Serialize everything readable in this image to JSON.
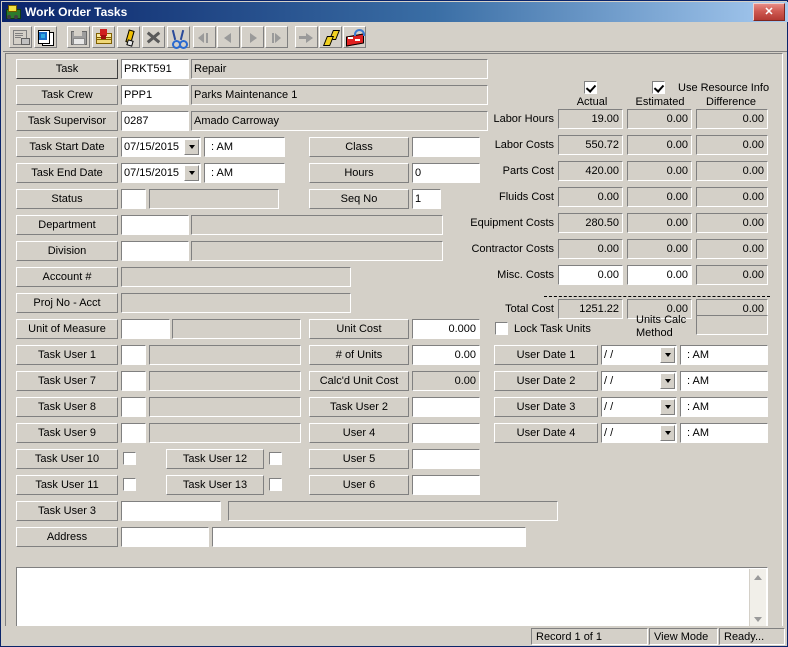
{
  "window": {
    "title": "Work Order Tasks",
    "icon": "bulldozer-icon",
    "close_label": "✕"
  },
  "toolbar": {
    "buttons": [
      {
        "name": "new-record-icon",
        "title": ""
      },
      {
        "name": "copy-record-icon",
        "title": ""
      },
      {
        "name": "save-icon",
        "title": ""
      },
      {
        "name": "post-icon",
        "title": ""
      },
      {
        "name": "edit-pencil-icon",
        "title": ""
      },
      {
        "name": "delete-x-icon",
        "title": ""
      },
      {
        "name": "cut-scissors-icon",
        "title": ""
      },
      {
        "name": "first-record-icon",
        "title": ""
      },
      {
        "name": "previous-record-icon",
        "title": ""
      },
      {
        "name": "next-record-icon",
        "title": ""
      },
      {
        "name": "last-record-icon",
        "title": ""
      },
      {
        "name": "goto-icon",
        "title": ""
      },
      {
        "name": "lightning-icon",
        "title": ""
      },
      {
        "name": "exit-icon",
        "title": ""
      }
    ]
  },
  "form": {
    "task": {
      "label": "Task",
      "code": "PRKT591",
      "description": "Repair"
    },
    "task_crew": {
      "label": "Task Crew",
      "code": "PPP1",
      "description": "Parks Maintenance 1"
    },
    "task_supervisor": {
      "label": "Task Supervisor",
      "code": "0287",
      "description": "Amado Carroway"
    },
    "task_start_date": {
      "label": "Task Start Date",
      "date": "07/15/2015",
      "time": ":   AM"
    },
    "task_end_date": {
      "label": "Task End Date",
      "date": "07/15/2015",
      "time": ":   AM"
    },
    "status": {
      "label": "Status",
      "code": "",
      "description": ""
    },
    "department": {
      "label": "Department",
      "code": "",
      "description": ""
    },
    "division": {
      "label": "Division",
      "code": "",
      "description": ""
    },
    "account_no": {
      "label": "Account #",
      "value": ""
    },
    "proj_no_acct": {
      "label": "Proj No - Acct",
      "value": ""
    },
    "unit_of_measure": {
      "label": "Unit of Measure",
      "code": "",
      "description": ""
    },
    "task_user_1": {
      "label": "Task User 1",
      "code": "",
      "description": ""
    },
    "task_user_7": {
      "label": "Task User 7",
      "code": "",
      "description": ""
    },
    "task_user_8": {
      "label": "Task User 8",
      "code": "",
      "description": ""
    },
    "task_user_9": {
      "label": "Task User 9",
      "code": "",
      "description": ""
    },
    "task_user_10": {
      "label": "Task User 10",
      "checked": false
    },
    "task_user_11": {
      "label": "Task User 11",
      "checked": false
    },
    "task_user_12": {
      "label": "Task User 12",
      "checked": false
    },
    "task_user_13": {
      "label": "Task User 13",
      "checked": false
    },
    "task_user_3": {
      "label": "Task User 3",
      "code": "",
      "description": ""
    },
    "address": {
      "label": "Address",
      "code": "",
      "description": ""
    },
    "class": {
      "label": "Class",
      "value": ""
    },
    "hours": {
      "label": "Hours",
      "value": "0"
    },
    "seq_no": {
      "label": "Seq No",
      "value": "1"
    },
    "unit_cost": {
      "label": "Unit Cost",
      "value": "0.000"
    },
    "num_of_units": {
      "label": "# of Units",
      "value": "0.00"
    },
    "calcd_unit_cost": {
      "label": "Calc'd Unit Cost",
      "value": "0.00"
    },
    "task_user_2": {
      "label": "Task User 2",
      "value": ""
    },
    "user_4": {
      "label": "User 4",
      "value": ""
    },
    "user_5": {
      "label": "User 5",
      "value": ""
    },
    "user_6": {
      "label": "User 6",
      "value": ""
    },
    "memo": {
      "value": ""
    }
  },
  "costs": {
    "use_resource_info_label": "Use Resource Info",
    "actual_checkbox_checked": true,
    "estimated_checkbox_checked": true,
    "columns": [
      "Actual",
      "Estimated",
      "Difference"
    ],
    "rows": [
      {
        "label": "Labor Hours",
        "actual": "19.00",
        "estimated": "0.00",
        "difference": "0.00",
        "editable": false
      },
      {
        "label": "Labor Costs",
        "actual": "550.72",
        "estimated": "0.00",
        "difference": "0.00",
        "editable": false
      },
      {
        "label": "Parts Cost",
        "actual": "420.00",
        "estimated": "0.00",
        "difference": "0.00",
        "editable": false
      },
      {
        "label": "Fluids Cost",
        "actual": "0.00",
        "estimated": "0.00",
        "difference": "0.00",
        "editable": false
      },
      {
        "label": "Equipment Costs",
        "actual": "280.50",
        "estimated": "0.00",
        "difference": "0.00",
        "editable": false
      },
      {
        "label": "Contractor Costs",
        "actual": "0.00",
        "estimated": "0.00",
        "difference": "0.00",
        "editable": false
      },
      {
        "label": "Misc. Costs",
        "actual": "0.00",
        "estimated": "0.00",
        "difference": "0.00",
        "editable": true
      }
    ],
    "total": {
      "label": "Total Cost",
      "actual": "1251.22",
      "estimated": "0.00",
      "difference": "0.00"
    }
  },
  "units": {
    "lock_task_units_label": "Lock Task Units",
    "lock_task_units_checked": false,
    "units_calc_method_label_1": "Units Calc",
    "units_calc_method_label_2": "Method",
    "units_calc_method_value": ""
  },
  "user_dates": [
    {
      "label": "User Date 1",
      "date": "/  /",
      "time": ":   AM"
    },
    {
      "label": "User Date 2",
      "date": "/  /",
      "time": ":   AM"
    },
    {
      "label": "User Date 3",
      "date": "/  /",
      "time": ":   AM"
    },
    {
      "label": "User Date 4",
      "date": "/  /",
      "time": ":   AM"
    }
  ],
  "statusbar": {
    "record": "Record 1 of 1",
    "mode": "View Mode",
    "ready": "Ready..."
  }
}
